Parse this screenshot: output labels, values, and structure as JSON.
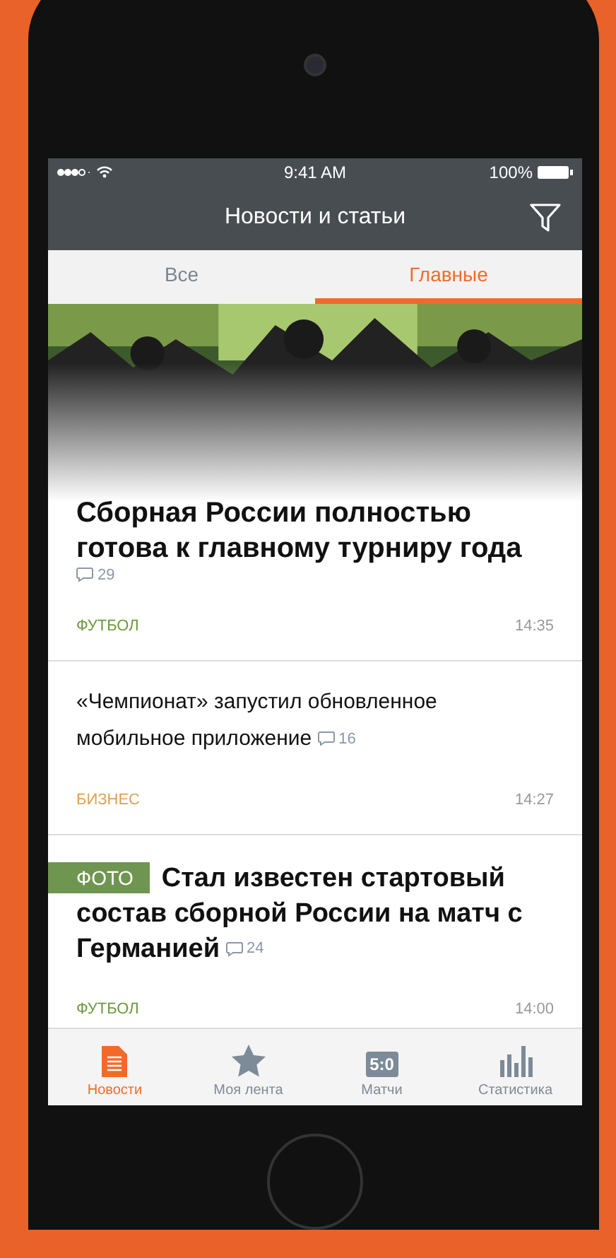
{
  "status_bar": {
    "time": "9:41 AM",
    "battery": "100%"
  },
  "nav_bar": {
    "title": "Новости и статьи"
  },
  "tabs": [
    {
      "label": "Все",
      "selected": false
    },
    {
      "label": "Главные",
      "selected": true
    }
  ],
  "articles": [
    {
      "kind": "featured",
      "title_lines": [
        "Сборная России полностью",
        "готова к главному турниру года"
      ],
      "comments": "29",
      "category": "ФУТБОЛ",
      "color": "#6a9a3c",
      "time": "14:35"
    },
    {
      "kind": "plain",
      "title_lines": [
        "«Чемпионат» запустил обновленное",
        "мобильное приложение"
      ],
      "comments": "16",
      "category": "БИЗНЕС",
      "color": "#e0a050",
      "time": "14:27"
    },
    {
      "badge": "ФОТО",
      "title_lines": [
        "Стал известен стартовый",
        "состав сборной России на матч с",
        "Германией"
      ],
      "comments": "24",
      "category": "ФУТБОЛ",
      "color": "#6a9a3c",
      "time": "14:00"
    }
  ],
  "tab_bar": [
    {
      "kind": "document",
      "label": "Новости",
      "selected": true
    },
    {
      "kind": "star",
      "label": "Моя лента",
      "selected": false
    },
    {
      "kind": "score",
      "icon_text": "5:0",
      "label": "Матчи",
      "selected": false
    },
    {
      "kind": "bars",
      "label": "Статистика",
      "selected": false
    }
  ]
}
